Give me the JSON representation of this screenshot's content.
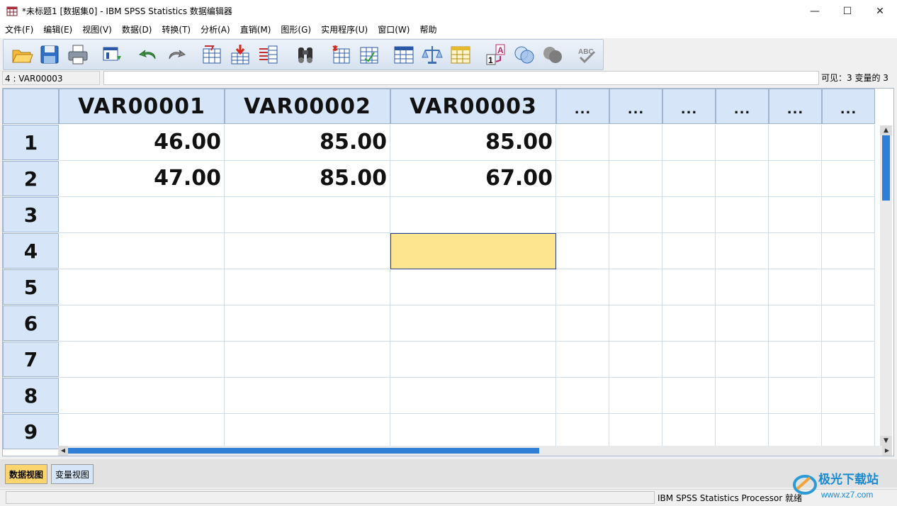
{
  "window": {
    "title": "*未标题1 [数据集0] - IBM SPSS Statistics 数据编辑器",
    "minimize": "—",
    "maximize": "☐",
    "close": "✕"
  },
  "menu": [
    "文件(F)",
    "编辑(E)",
    "视图(V)",
    "数据(D)",
    "转换(T)",
    "分析(A)",
    "直销(M)",
    "图形(G)",
    "实用程序(U)",
    "窗口(W)",
    "帮助"
  ],
  "toolbar": {
    "icons": [
      "open-icon",
      "save-icon",
      "print-icon",
      "recall-dialog-icon",
      "undo-icon",
      "redo-icon",
      "goto-case-icon",
      "goto-variable-icon",
      "variables-icon",
      "find-icon",
      "insert-cases-icon",
      "insert-variable-icon",
      "split-file-icon",
      "weight-cases-icon",
      "select-cases-icon",
      "value-labels-icon",
      "use-sets-icon",
      "show-all-variables-icon",
      "spell-check-icon"
    ]
  },
  "cell_editor": {
    "reference": "4 : VAR00003",
    "value": "",
    "visible_label": "可见：3 变量的 3"
  },
  "grid": {
    "columns": [
      "VAR00001",
      "VAR00002",
      "VAR00003"
    ],
    "empty_column_label": "...",
    "row_numbers": [
      "1",
      "2",
      "3",
      "4",
      "5",
      "6",
      "7",
      "8",
      "9"
    ],
    "rows": [
      [
        "46.00",
        "85.00",
        "85.00"
      ],
      [
        "47.00",
        "85.00",
        "67.00"
      ]
    ],
    "selected_cell": {
      "row": 4,
      "column": "VAR00003"
    }
  },
  "tabs": {
    "data_view": "数据视图",
    "variable_view": "变量视图",
    "active": "data_view"
  },
  "status": {
    "processor": "IBM SPSS Statistics Processor 就绪"
  },
  "watermark": {
    "text": "极光下载站",
    "url": "www.xz7.com"
  },
  "colors": {
    "header_bg": "#d6e6f8",
    "selected_cell": "#fde48e",
    "active_tab": "#fcd56f"
  }
}
